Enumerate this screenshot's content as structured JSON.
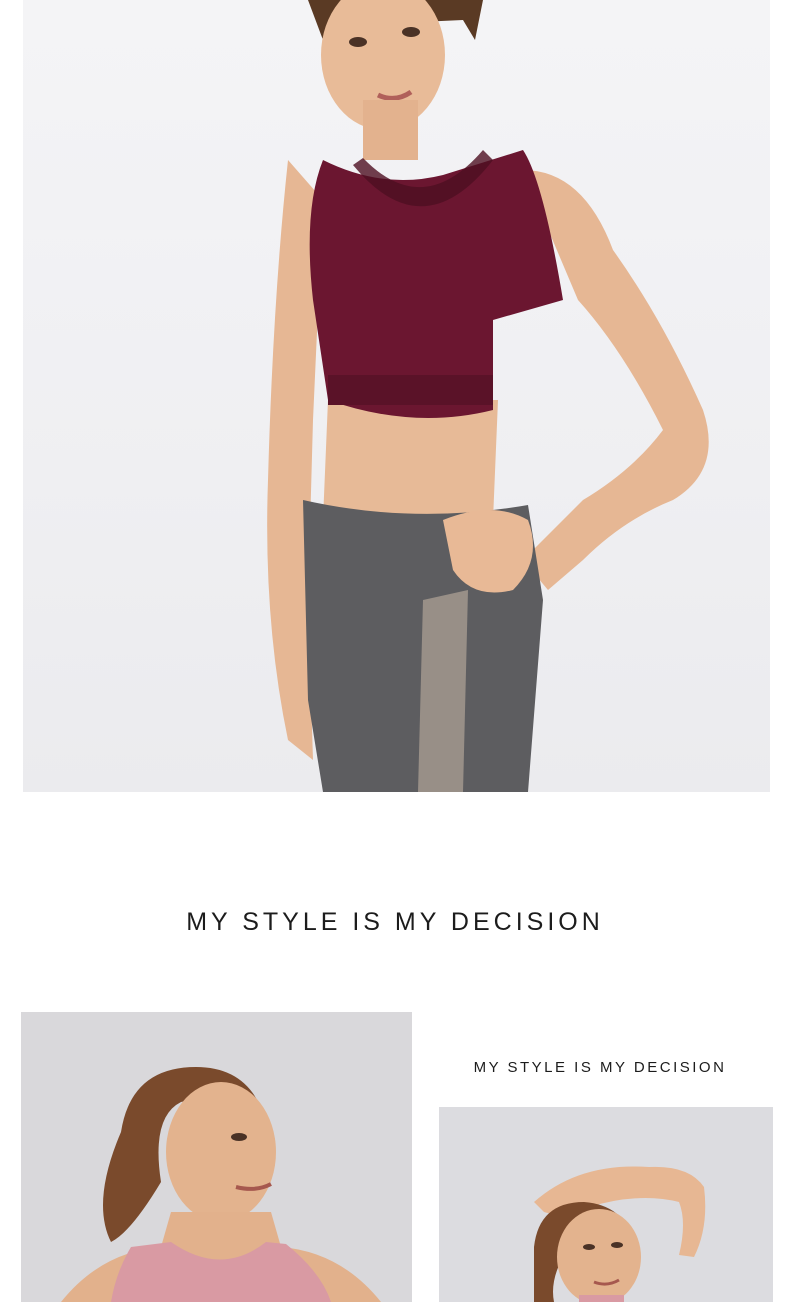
{
  "headline": "MY STYLE IS MY DECISION",
  "subheadline": "MY STYLE IS MY DECISION",
  "colors": {
    "tank_top": "#6b1630",
    "leggings": "#5d5d60",
    "pink_top": "#d99aa3",
    "skin": "#e6b794",
    "hair": "#7a4a2c"
  }
}
